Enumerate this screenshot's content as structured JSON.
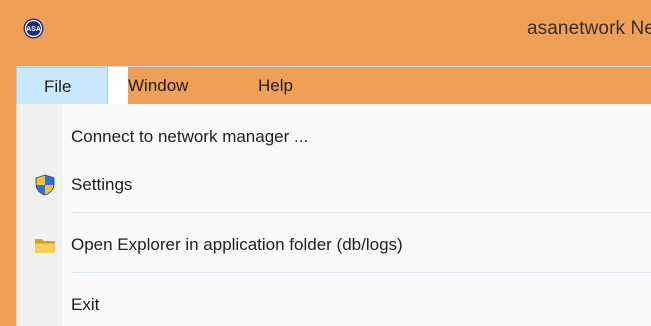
{
  "window": {
    "title": "asanetwork Ne",
    "app_icon": "asa-logo-icon",
    "app_icon_text": "ASA"
  },
  "menubar": {
    "items": [
      {
        "label": "File",
        "active": true
      },
      {
        "label": "Window"
      },
      {
        "label": "Help"
      }
    ]
  },
  "file_menu": {
    "items": [
      {
        "label": "Connect to network manager ...",
        "icon": null
      },
      {
        "label": "Settings",
        "icon": "shield-icon"
      },
      {
        "label": "Open Explorer in application folder (db/logs)",
        "icon": "folder-icon"
      },
      {
        "label": "Exit",
        "icon": null
      }
    ]
  },
  "colors": {
    "titlebar": "#f0a056",
    "menu_highlight": "#cce8ff",
    "menu_highlight_border": "#99d1ff"
  }
}
